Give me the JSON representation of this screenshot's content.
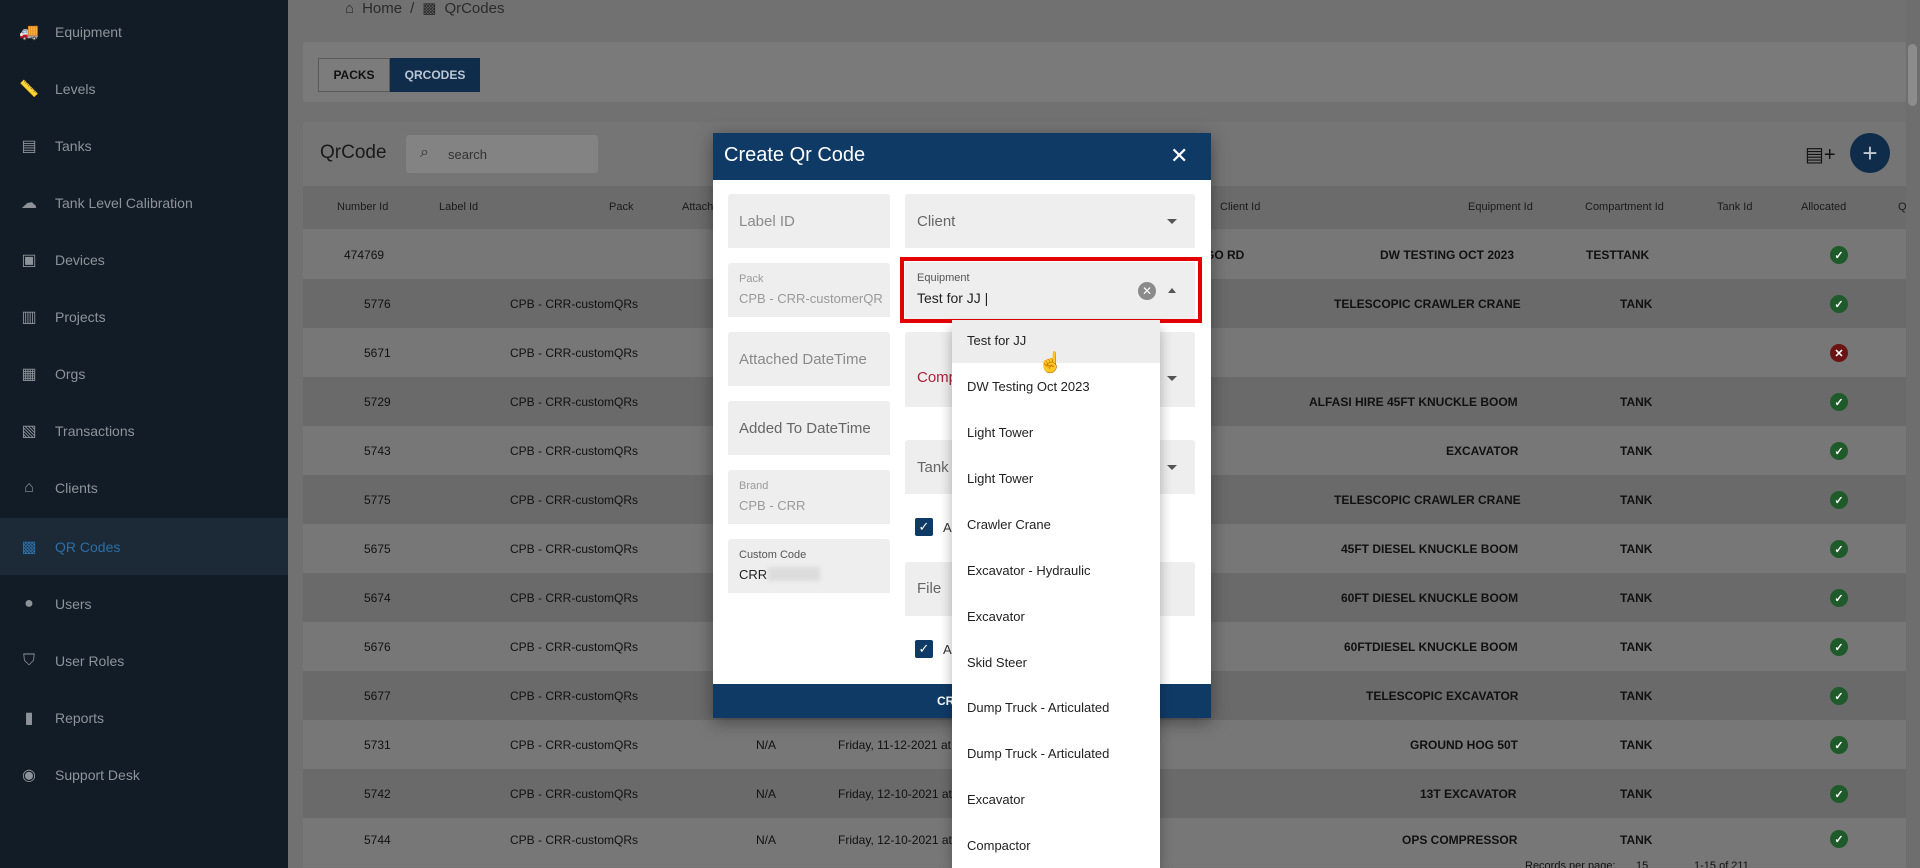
{
  "sidebar": {
    "items": [
      {
        "label": "Equipment",
        "icon": "truck-icon"
      },
      {
        "label": "Levels",
        "icon": "ruler-icon"
      },
      {
        "label": "Tanks",
        "icon": "tank-icon"
      },
      {
        "label": "Tank Level Calibration",
        "icon": "cloud-icon"
      },
      {
        "label": "Devices",
        "icon": "device-icon"
      },
      {
        "label": "Projects",
        "icon": "map-icon"
      },
      {
        "label": "Orgs",
        "icon": "building-icon"
      },
      {
        "label": "Transactions",
        "icon": "document-icon"
      },
      {
        "label": "Clients",
        "icon": "bank-icon"
      },
      {
        "label": "QR Codes",
        "icon": "qr-icon"
      },
      {
        "label": "Users",
        "icon": "user-icon"
      },
      {
        "label": "User Roles",
        "icon": "shield-icon"
      },
      {
        "label": "Reports",
        "icon": "chart-icon"
      },
      {
        "label": "Support Desk",
        "icon": "support-icon"
      }
    ],
    "active": "QR Codes"
  },
  "breadcrumb": {
    "home": "Home",
    "separator": "/",
    "current": "QrCodes"
  },
  "tabs": {
    "packs": "PACKS",
    "qrcodes": "QRCODES"
  },
  "card": {
    "title": "QrCode",
    "search_placeholder": "search"
  },
  "table": {
    "headers": {
      "number_id": "Number Id",
      "label_id": "Label Id",
      "pack": "Pack",
      "attached": "Attach",
      "client_id": "Client Id",
      "equipment_id": "Equipment Id",
      "compartment_id": "Compartment Id",
      "tank_id": "Tank Id",
      "allocated": "Allocated",
      "q": "Q"
    },
    "rows": [
      {
        "number": "474769",
        "pack": "",
        "attached": "",
        "date": "",
        "client": "GO RD",
        "equipment": "DW TESTING OCT 2023",
        "compartment": "TESTTANK",
        "allocated": "yes"
      },
      {
        "number": "5776",
        "pack": "CPB - CRR-customQRs",
        "attached": "",
        "date": "",
        "client": "",
        "equipment": "TELESCOPIC CRAWLER CRANE",
        "compartment": "TANK",
        "allocated": "yes"
      },
      {
        "number": "5671",
        "pack": "CPB - CRR-customQRs",
        "attached": "",
        "date": "",
        "client": "",
        "equipment": "",
        "compartment": "",
        "allocated": "no"
      },
      {
        "number": "5729",
        "pack": "CPB - CRR-customQRs",
        "attached": "",
        "date": "",
        "client": "",
        "equipment": "ALFASI HIRE 45FT KNUCKLE BOOM",
        "compartment": "TANK",
        "allocated": "yes"
      },
      {
        "number": "5743",
        "pack": "CPB - CRR-customQRs",
        "attached": "",
        "date": "",
        "client": "",
        "equipment": "EXCAVATOR",
        "compartment": "TANK",
        "allocated": "yes"
      },
      {
        "number": "5775",
        "pack": "CPB - CRR-customQRs",
        "attached": "",
        "date": "",
        "client": "",
        "equipment": "TELESCOPIC CRAWLER CRANE",
        "compartment": "TANK",
        "allocated": "yes"
      },
      {
        "number": "5675",
        "pack": "CPB - CRR-customQRs",
        "attached": "",
        "date": "",
        "client": "",
        "equipment": "45FT DIESEL KNUCKLE BOOM",
        "compartment": "TANK",
        "allocated": "yes"
      },
      {
        "number": "5674",
        "pack": "CPB - CRR-customQRs",
        "attached": "",
        "date": "",
        "client": "",
        "equipment": "60FT DIESEL KNUCKLE BOOM",
        "compartment": "TANK",
        "allocated": "yes"
      },
      {
        "number": "5676",
        "pack": "CPB - CRR-customQRs",
        "attached": "",
        "date": "",
        "client": "",
        "equipment": "60FTDIESEL KNUCKLE BOOM",
        "compartment": "TANK",
        "allocated": "yes"
      },
      {
        "number": "5677",
        "pack": "CPB - CRR-customQRs",
        "attached": "",
        "date": "",
        "client": "",
        "equipment": "TELESCOPIC EXCAVATOR",
        "compartment": "TANK",
        "allocated": "yes"
      },
      {
        "number": "5731",
        "pack": "CPB - CRR-customQRs",
        "attached": "N/A",
        "date": "Friday, 11-12-2021 at",
        "client": "",
        "equipment": "GROUND HOG 50T",
        "compartment": "TANK",
        "allocated": "yes"
      },
      {
        "number": "5742",
        "pack": "CPB - CRR-customQRs",
        "attached": "N/A",
        "date": "Friday, 12-10-2021 at",
        "client": "",
        "equipment": "13T EXCAVATOR",
        "compartment": "TANK",
        "allocated": "yes"
      },
      {
        "number": "5744",
        "pack": "CPB - CRR-customQRs",
        "attached": "N/A",
        "date": "Friday, 12-10-2021 at",
        "client": "",
        "equipment": "OPS COMPRESSOR",
        "compartment": "TANK",
        "allocated": "yes"
      }
    ],
    "footer": {
      "records_per_page": "Records per page:",
      "per_page": "15",
      "range": "1-15 of 211"
    }
  },
  "modal": {
    "title": "Create Qr Code",
    "fields": {
      "label_id": {
        "placeholder": "Label ID"
      },
      "pack": {
        "label": "Pack",
        "value": "CPB - CRR-customerQR"
      },
      "attached_datetime": {
        "placeholder": "Attached DateTime"
      },
      "added_to_datetime": {
        "placeholder": "Added To DateTime"
      },
      "brand": {
        "label": "Brand",
        "value": "CPB - CRR"
      },
      "custom_code": {
        "label": "Custom Code",
        "value": "CRR"
      },
      "client": {
        "placeholder": "Client"
      },
      "equipment": {
        "label": "Equipment",
        "value": "Test for JJ |"
      },
      "compartment": {
        "placeholder": "Comp"
      },
      "tank": {
        "placeholder": "Tank"
      },
      "file": {
        "placeholder": "File"
      },
      "checkbox1_label": "A",
      "checkbox2_label": "A"
    },
    "submit_label": "CR",
    "equipment_options": [
      "Test for JJ",
      "DW Testing Oct 2023",
      "Light Tower",
      "Light Tower",
      "Crawler Crane",
      "Excavator - Hydraulic",
      "Excavator",
      "Skid Steer",
      "Dump Truck - Articulated",
      "Dump Truck - Articulated",
      "Excavator",
      "Compactor"
    ]
  },
  "colors": {
    "primary": "#103a66",
    "highlight": "#e30000",
    "sidebar": "#121c26"
  }
}
